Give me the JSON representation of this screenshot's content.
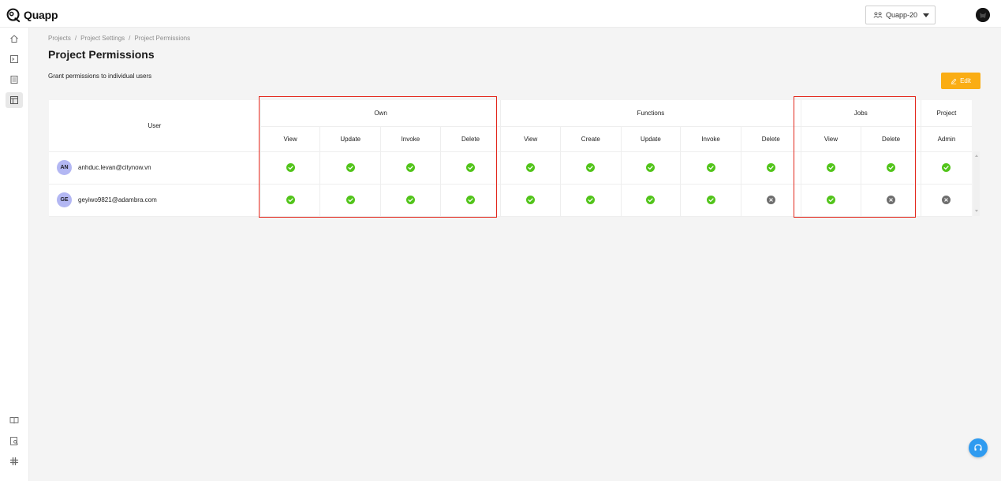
{
  "app": {
    "name": "Quapp"
  },
  "header": {
    "project_selector": {
      "selected": "Quapp-20"
    }
  },
  "sidebar": {
    "top_items": [
      {
        "icon": "home-icon"
      },
      {
        "icon": "terminal-icon"
      },
      {
        "icon": "document-icon"
      },
      {
        "icon": "settings-panel-icon",
        "active": true
      }
    ],
    "bottom_items": [
      {
        "icon": "book-icon"
      },
      {
        "icon": "search-document-icon"
      },
      {
        "icon": "slack-icon"
      }
    ]
  },
  "breadcrumb": [
    "Projects",
    "Project Settings",
    "Project Permissions"
  ],
  "breadcrumb_separator": "/",
  "page": {
    "title": "Project Permissions",
    "subtitle": "Grant permissions to individual users",
    "edit_label": "Edit"
  },
  "table": {
    "user_header": "User",
    "groups": [
      {
        "label": "Own",
        "columns": [
          "View",
          "Update",
          "Invoke",
          "Delete"
        ]
      },
      {
        "label": "Functions",
        "columns": [
          "View",
          "Create",
          "Update",
          "Invoke",
          "Delete"
        ]
      },
      {
        "label": "Jobs",
        "columns": [
          "View",
          "Delete"
        ]
      },
      {
        "label": "Project",
        "columns": [
          "Admin"
        ]
      }
    ],
    "rows": [
      {
        "initials": "AN",
        "email": "anhduc.levan@citynow.vn",
        "permissions": [
          true,
          true,
          true,
          true,
          true,
          true,
          true,
          true,
          true,
          true,
          true,
          true
        ]
      },
      {
        "initials": "GE",
        "email": "geyiwo9821@adambra.com",
        "permissions": [
          true,
          true,
          true,
          true,
          true,
          true,
          true,
          true,
          false,
          true,
          false,
          false
        ]
      }
    ]
  },
  "colors": {
    "check": "#52c41a",
    "cross": "#6e6e6e",
    "accent": "#faad14",
    "avatar": "#b3b7f3",
    "highlight": "#e3271c",
    "support": "#2f9bf0"
  }
}
